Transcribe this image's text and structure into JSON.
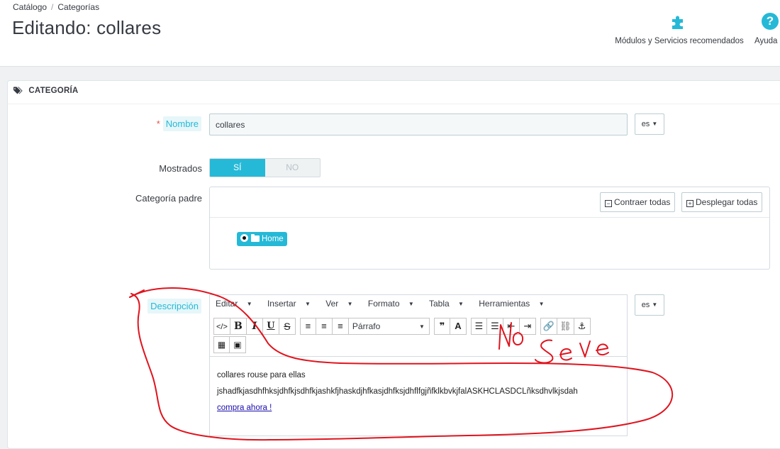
{
  "breadcrumb": {
    "catalog": "Catálogo",
    "separator": "/",
    "categories": "Categorías"
  },
  "page_title": "Editando: collares",
  "toolbar": {
    "modules_label": "Módulos y Servicios recomendados",
    "modules_icon": "puzzle-icon",
    "help_label": "Ayuda",
    "help_icon": "question-circle-icon",
    "help_glyph": "?"
  },
  "panel": {
    "heading": "CATEGORÍA",
    "heading_icon": "tag-icon"
  },
  "form": {
    "name": {
      "required_mark": "*",
      "label": "Nombre",
      "value": "collares",
      "lang": "es"
    },
    "displayed": {
      "label": "Mostrados",
      "yes": "SÍ",
      "no": "NO",
      "selected": "SÍ"
    },
    "parent": {
      "label": "Categoría padre",
      "collapse_label": "Contraer todas",
      "expand_label": "Desplegar todas",
      "collapse_icon": "minus-square-icon",
      "expand_icon": "plus-square-icon",
      "selected_node": "Home"
    },
    "description": {
      "label": "Descripción",
      "lang": "es",
      "menus": [
        "Editar",
        "Insertar",
        "Ver",
        "Formato",
        "Tabla",
        "Herramientas"
      ],
      "format_select": "Párrafo",
      "content": {
        "line1": "collares rouse para ellas",
        "line2": "jshadfkjasdhfhksjdhfkjsdhfkjashkfjhaskdjhfkasjdhfksjdhflfgjñfklkbvkjfalASKHCLASDCLñksdhvlkjsdah",
        "link": "compra ahora !"
      }
    }
  },
  "colors": {
    "accent": "#25b9d7",
    "required": "#e3534b",
    "annotation": "#e0141e"
  }
}
